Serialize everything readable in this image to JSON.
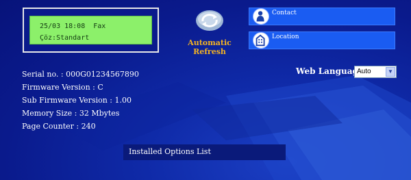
{
  "lcd": {
    "line1": "25/03 18:08  Fax",
    "line2": "Çöz:Standart"
  },
  "refresh": {
    "line1": "Automatic",
    "line2": "Refresh"
  },
  "nav": {
    "contact": "Contact",
    "location": "Location"
  },
  "device_info": [
    "Serial no. : 000G01234567890",
    "Firmware Version : C",
    "Sub Firmware Version : 1.00",
    "Memory Size : 32 Mbytes",
    "Page Counter : 240"
  ],
  "language": {
    "label": "Web Language:",
    "selected": "Auto"
  },
  "options": {
    "label": "Installed Options List"
  },
  "colors": {
    "background": "#0a1a8c",
    "lcd": "#8cf06a",
    "button": "#1a5cf2",
    "refresh_text": "#f4b322"
  }
}
